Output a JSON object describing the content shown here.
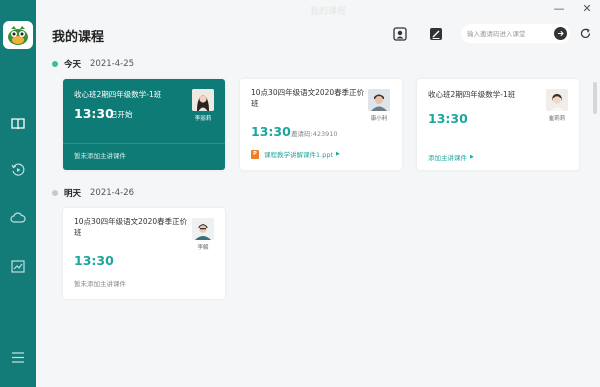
{
  "window": {
    "title": "我的课程",
    "minimize": "—",
    "close": "✕"
  },
  "sidebar": {
    "logo": "app-logo",
    "items": [
      {
        "icon": "book-icon",
        "active": true
      },
      {
        "icon": "replay-icon",
        "active": false
      },
      {
        "icon": "cloud-icon",
        "active": false
      },
      {
        "icon": "chart-icon",
        "active": false
      }
    ],
    "menu_icon": "menu-icon"
  },
  "header": {
    "title": "我的课程",
    "search_placeholder": "输入邀请码进入课堂",
    "icons": [
      "user-badge-icon",
      "edit-icon",
      "arrow-right-icon",
      "refresh-icon"
    ]
  },
  "days": [
    {
      "label": "今天",
      "date": "2021-4-25",
      "color": "#3cbf98",
      "cards": [
        {
          "title": "收心班2期四年级数学-1班",
          "time": "13:30",
          "status": "已开始",
          "teacher": "李丽莉",
          "footer": "暂未添加主讲课件",
          "active": true
        },
        {
          "title": "10点30四年级语文2020春季正价班",
          "time": "13:30",
          "invite": "邀请码:423910",
          "teacher": "康小利",
          "footer": "课程教学讲解课件1.ppt",
          "footer_type": "ppt",
          "active": false
        },
        {
          "title": "收心班2期四年级数学-1班",
          "time": "13:30",
          "teacher": "崔莉莉",
          "footer": "添加主讲课件",
          "footer_type": "link",
          "active": false
        }
      ]
    },
    {
      "label": "明天",
      "date": "2021-4-26",
      "color": "#c9c9c9",
      "cards": [
        {
          "title": "10点30四年级语文2020春季正价班",
          "time": "13:30",
          "teacher": "李解",
          "footer": "暂未添加主讲课件",
          "active": false
        }
      ]
    }
  ],
  "colors": {
    "sidebar": "#137c78",
    "accent": "#1fa69b",
    "active_card": "#0f7b77",
    "ppt": "#f07c28"
  }
}
